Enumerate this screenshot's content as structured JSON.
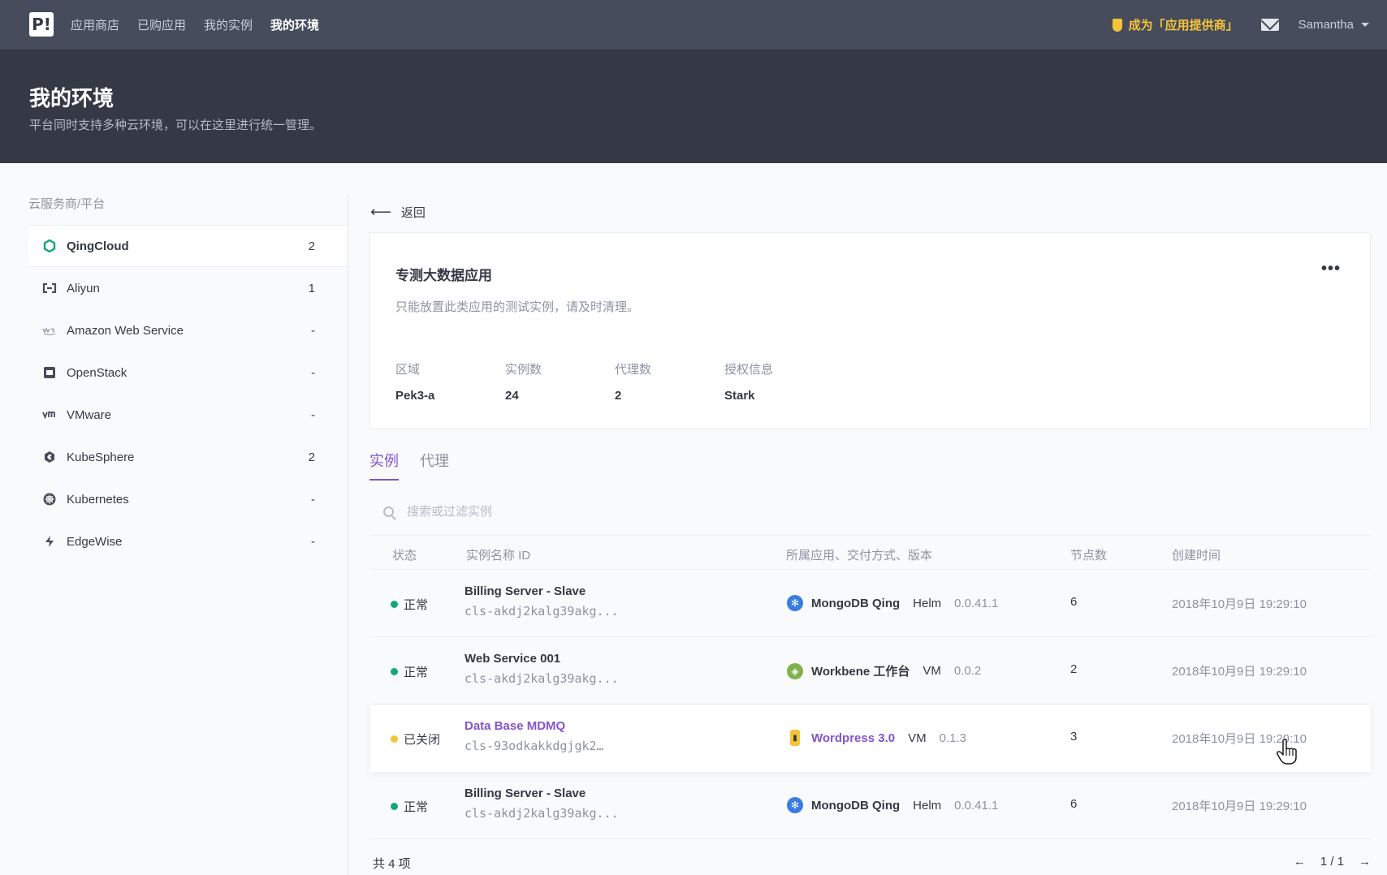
{
  "nav": {
    "logo": "P!",
    "links": [
      "应用商店",
      "已购应用",
      "我的实例",
      "我的环境"
    ],
    "active_index": 3,
    "provider_link": "成为「应用提供商」",
    "user": "Samantha"
  },
  "header": {
    "title": "我的环境",
    "subtitle": "平台同时支持多种云环境，可以在这里进行统一管理。"
  },
  "sidebar": {
    "title": "云服务商/平台",
    "items": [
      {
        "label": "QingCloud",
        "count": "2",
        "icon": "qingcloud-icon",
        "active": true
      },
      {
        "label": "Aliyun",
        "count": "1",
        "icon": "aliyun-icon"
      },
      {
        "label": "Amazon Web Service",
        "count": "-",
        "icon": "aws-icon"
      },
      {
        "label": "OpenStack",
        "count": "-",
        "icon": "openstack-icon"
      },
      {
        "label": "VMware",
        "count": "-",
        "icon": "vmware-icon"
      },
      {
        "label": "KubeSphere",
        "count": "2",
        "icon": "kubesphere-icon"
      },
      {
        "label": "Kubernetes",
        "count": "-",
        "icon": "kubernetes-icon"
      },
      {
        "label": "EdgeWise",
        "count": "-",
        "icon": "edgewise-icon"
      }
    ]
  },
  "back_label": "返回",
  "env": {
    "title": "专测大数据应用",
    "desc": "只能放置此类应用的测试实例，请及时清理。",
    "more": "•••",
    "stats": [
      {
        "label": "区域",
        "value": "Pek3-a"
      },
      {
        "label": "实例数",
        "value": "24"
      },
      {
        "label": "代理数",
        "value": "2"
      },
      {
        "label": "授权信息",
        "value": "Stark"
      }
    ]
  },
  "tabs": [
    "实例",
    "代理"
  ],
  "search": {
    "placeholder": "搜索或过滤实例"
  },
  "table": {
    "headers": [
      "状态",
      "实例名称 ID",
      "所属应用、交付方式、版本",
      "节点数",
      "创建时间"
    ],
    "rows": [
      {
        "status": "正常",
        "status_color": "#15a773",
        "name": "Billing Server - Slave",
        "id": "cls-akdj2kalg39akg...",
        "app": "MongoDB Qing",
        "app_icon": "helm-icon",
        "mode": "Helm",
        "version": "0.0.41.1",
        "nodes": "6",
        "created": "2018年10月9日 19:29:10"
      },
      {
        "status": "正常",
        "status_color": "#15a773",
        "name": "Web Service 001",
        "id": "cls-akdj2kalg39akg...",
        "app": "Workbene 工作台",
        "app_icon": "workbench-icon",
        "mode": "VM",
        "version": "0.0.2",
        "nodes": "2",
        "created": "2018年10月9日 19:29:10"
      },
      {
        "status": "已关闭",
        "status_color": "#f5c337",
        "name": "Data Base MDMQ",
        "id": "cls-93odkakkdgjgk2…",
        "app": "Wordpress 3.0",
        "app_icon": "wordpress-icon",
        "mode": "VM",
        "version": "0.1.3",
        "nodes": "3",
        "created": "2018年10月9日 19:29:10"
      },
      {
        "status": "正常",
        "status_color": "#15a773",
        "name": "Billing Server - Slave",
        "id": "cls-akdj2kalg39akg...",
        "app": "MongoDB Qing",
        "app_icon": "helm-icon",
        "mode": "Helm",
        "version": "0.0.41.1",
        "nodes": "6",
        "created": "2018年10月9日 19:29:10"
      }
    ]
  },
  "footer": {
    "total": "共 4 项",
    "prev": "←",
    "page": "1 / 1",
    "next": "→"
  },
  "colors": {
    "accent": "#8454cd",
    "ok": "#15a773",
    "warn": "#f5c337"
  }
}
